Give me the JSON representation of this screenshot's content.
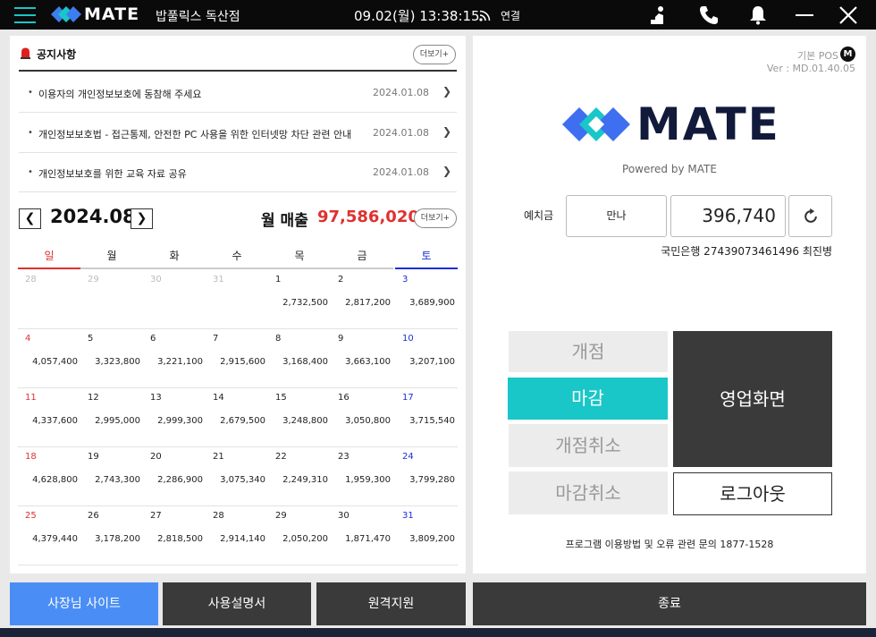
{
  "titlebar": {
    "app_name": "MATE",
    "store_name": "밥풀릭스 독산점",
    "datetime": "09.02(월) 13:38:15",
    "connection": "연결"
  },
  "notice": {
    "title": "공지사항",
    "more": "더보기+",
    "items": [
      {
        "text": "이용자의 개인정보보호에 동참해 주세요",
        "date": "2024.01.08",
        "arrow": "❯"
      },
      {
        "text": "개인정보보호법 - 접근통제, 안전한 PC 사용을 위한 인터넷망 차단 관련 안내",
        "date": "2024.01.08",
        "arrow": "❯"
      },
      {
        "text": "개인정보보호를 위한 교육 자료 공유",
        "date": "2024.01.08",
        "arrow": "❯"
      }
    ]
  },
  "calendar": {
    "prev": "❮",
    "next": "❯",
    "month": "2024.08",
    "sales_label": "월 매출",
    "sales_value": "97,586,020",
    "more": "더보기+",
    "weekdays": [
      "일",
      "월",
      "화",
      "수",
      "목",
      "금",
      "토"
    ],
    "weeks": [
      [
        {
          "day": "28",
          "amt": ""
        },
        {
          "day": "29",
          "amt": ""
        },
        {
          "day": "30",
          "amt": ""
        },
        {
          "day": "31",
          "amt": ""
        },
        {
          "day": "1",
          "amt": "2,732,500"
        },
        {
          "day": "2",
          "amt": "2,817,200"
        },
        {
          "day": "3",
          "amt": "3,689,900"
        }
      ],
      [
        {
          "day": "4",
          "amt": "4,057,400"
        },
        {
          "day": "5",
          "amt": "3,323,800"
        },
        {
          "day": "6",
          "amt": "3,221,100"
        },
        {
          "day": "7",
          "amt": "2,915,600"
        },
        {
          "day": "8",
          "amt": "3,168,400"
        },
        {
          "day": "9",
          "amt": "3,663,100"
        },
        {
          "day": "10",
          "amt": "3,207,100"
        }
      ],
      [
        {
          "day": "11",
          "amt": "4,337,600"
        },
        {
          "day": "12",
          "amt": "2,995,000"
        },
        {
          "day": "13",
          "amt": "2,999,300"
        },
        {
          "day": "14",
          "amt": "2,679,500"
        },
        {
          "day": "15",
          "amt": "3,248,800"
        },
        {
          "day": "16",
          "amt": "3,050,800"
        },
        {
          "day": "17",
          "amt": "3,715,540"
        }
      ],
      [
        {
          "day": "18",
          "amt": "4,628,800"
        },
        {
          "day": "19",
          "amt": "2,743,300"
        },
        {
          "day": "20",
          "amt": "2,286,900"
        },
        {
          "day": "21",
          "amt": "3,075,340"
        },
        {
          "day": "22",
          "amt": "2,249,310"
        },
        {
          "day": "23",
          "amt": "1,959,300"
        },
        {
          "day": "24",
          "amt": "3,799,280"
        }
      ],
      [
        {
          "day": "25",
          "amt": "4,379,440"
        },
        {
          "day": "26",
          "amt": "3,178,200"
        },
        {
          "day": "27",
          "amt": "2,818,500"
        },
        {
          "day": "28",
          "amt": "2,914,140"
        },
        {
          "day": "29",
          "amt": "2,050,200"
        },
        {
          "day": "30",
          "amt": "1,871,470"
        },
        {
          "day": "31",
          "amt": "3,809,200"
        }
      ]
    ]
  },
  "right": {
    "pos_type": "기본 POS",
    "m_badge": "M",
    "version": "Ver : MD.01.40.05",
    "logo_text": "MATE",
    "powered_by": "Powered by MATE",
    "deposit_label": "예치금",
    "deposit_bank": "만나",
    "deposit_amount": "396,740",
    "account_info": "국민은행 27439073461496    최진병",
    "open_label": "개점",
    "close_label": "마감",
    "cancel_open_label": "개점취소",
    "cancel_close_label": "마감취소",
    "business_label": "영업화면",
    "logout_label": "로그아웃",
    "help_text": "프로그램 이용방법 및 오류 관련 문의 1877-1528"
  },
  "bottom": {
    "owner_site": "사장님 사이트",
    "manual": "사용설명서",
    "remote": "원격지원",
    "exit": "종료"
  },
  "colors": {
    "accent": "#19c6c8",
    "brand_blue": "#4a8ef5",
    "sales_red": "#e03030",
    "saturday_blue": "#1a2fd6"
  },
  "icons": [
    "menu-icon",
    "mate-logo-icon",
    "wifi-icon",
    "person-icon",
    "phone-icon",
    "bell-icon",
    "minimize-icon",
    "close-icon",
    "notice-siren-icon",
    "refresh-icon"
  ]
}
